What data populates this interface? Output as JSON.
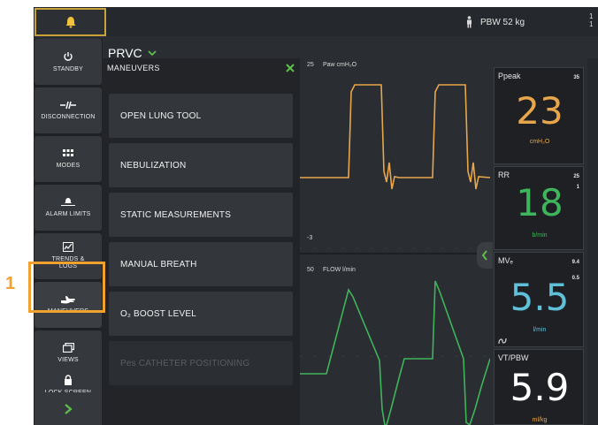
{
  "topbar": {
    "pbw_label": "PBW 52 kg",
    "edge_text": "1\n1"
  },
  "mode": {
    "title": "PRVC"
  },
  "sidebar": {
    "items": [
      {
        "label": "STANDBY",
        "icon": "power-icon"
      },
      {
        "label": "DISCONNECTION",
        "icon": "disconnection-icon"
      },
      {
        "label": "MODES",
        "icon": "grid-icon"
      },
      {
        "label": "ALARM LIMITS",
        "icon": "alarm-limits-icon"
      },
      {
        "label": "TRENDS & LOGS",
        "icon": "trends-icon"
      },
      {
        "label": "MANEUVERS",
        "icon": "hand-icon"
      },
      {
        "label": "VIEWS",
        "icon": "views-icon"
      },
      {
        "label": "LOCK SCREEN",
        "icon": "lock-icon"
      }
    ]
  },
  "panel": {
    "title": "MANEUVERS",
    "items": [
      {
        "label": "OPEN LUNG TOOL",
        "enabled": true
      },
      {
        "label": "NEBULIZATION",
        "enabled": true
      },
      {
        "label": "STATIC MEASUREMENTS",
        "enabled": true
      },
      {
        "label": "MANUAL BREATH",
        "enabled": true
      },
      {
        "label": "O₂ BOOST LEVEL",
        "enabled": true
      },
      {
        "label": "Pes CATHETER POSITIONING",
        "enabled": false
      }
    ]
  },
  "waveforms": {
    "paw": {
      "label": "Paw cmH₂O",
      "scale_top": "25",
      "scale_bottom": "-3",
      "color": "#e8a64a"
    },
    "flow": {
      "label": "FLOW l/min",
      "scale_top": "50",
      "color": "#3fb55b"
    }
  },
  "tiles": [
    {
      "name": "Ppeak",
      "limit": "35",
      "value": "23",
      "unit": "cmH₂O",
      "color": "#e8a64a"
    },
    {
      "name": "RR",
      "limit": "25",
      "limit2": "1",
      "value": "18",
      "unit": "b/min",
      "color": "#3fb55b"
    },
    {
      "name": "MVₑ",
      "limit": "9.4",
      "limit2": "0.5",
      "value": "5.5",
      "unit": "l/min",
      "color": "#5fc0d8"
    },
    {
      "name": "VT/PBW",
      "limit": "",
      "value": "5.9",
      "unit": "ml/kg",
      "color": "#ffffff"
    }
  ],
  "callout": {
    "number": "1"
  },
  "colors": {
    "accent": "#f0a12e",
    "alarm_border": "#c8a23a",
    "panel_close": "#5fbf4a"
  }
}
